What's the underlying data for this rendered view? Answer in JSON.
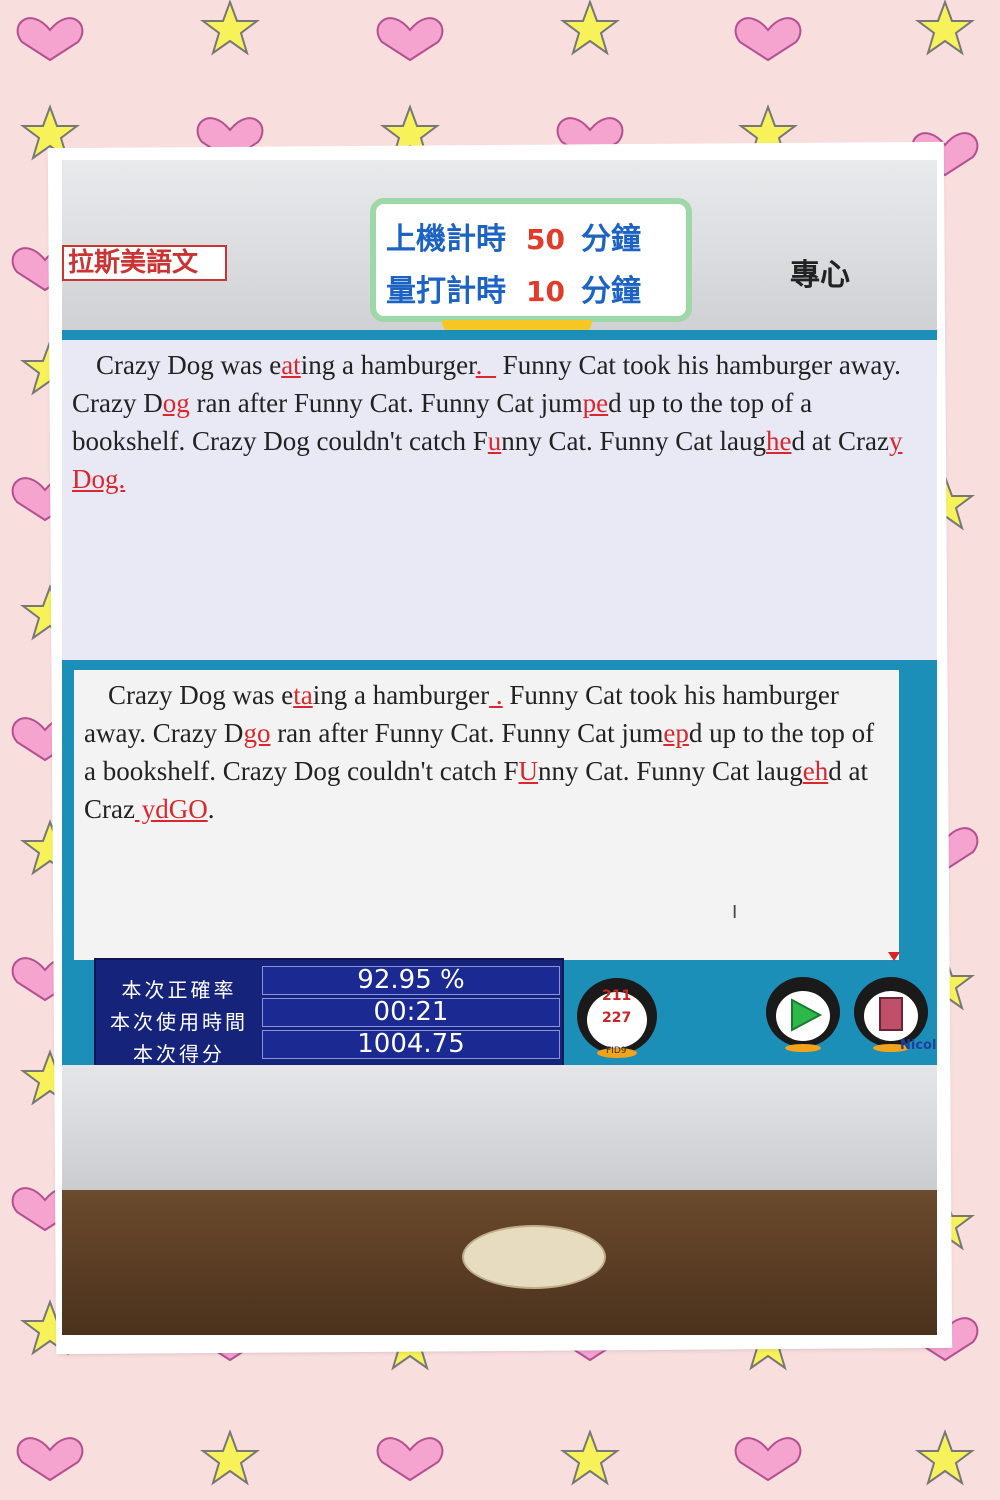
{
  "sign_left": "拉斯美語文",
  "sign_right": "專心",
  "timer_card": {
    "row1_label": "上機計時",
    "row1_value": "50",
    "row1_unit": "分鐘",
    "row2_label": "量打計時",
    "row2_value": "10",
    "row2_unit": "分鐘"
  },
  "original_text": [
    "Crazy Dog was e",
    "at",
    "ing a hamburger",
    "._",
    " Funny Cat took his hamburger away.  Crazy D",
    "og",
    " ran after Funny Cat.  Funny Cat jum",
    "pe",
    "d up to the top of a bookshelf.  Crazy Dog couldn't catch F",
    "u",
    "nny Cat.  Funny Cat laug",
    "he",
    "d at Craz",
    "y Dog."
  ],
  "typed_text": [
    "Crazy Dog was e",
    "ta",
    "ing a hamburger",
    " .",
    " Funny Cat took his hamburger away.  Crazy D",
    "go",
    " ran after Funny Cat.  Funny Cat jum",
    "ep",
    "d up to the top of a bookshelf.  Crazy Dog couldn't catch F",
    "U",
    "nny Cat.  Funny Cat laug",
    "eh",
    "d at Craz",
    " ydGO",
    "."
  ],
  "stats": {
    "accuracy_label": "本次正確率",
    "accuracy_value": "92.95 %",
    "time_label": "本次使用時間",
    "time_value": "00:21",
    "score_label": "本次得分",
    "score_value": "1004.75"
  },
  "counter": {
    "current": "211",
    "total": "227",
    "label": "FID9"
  },
  "user_name": "Nicol"
}
